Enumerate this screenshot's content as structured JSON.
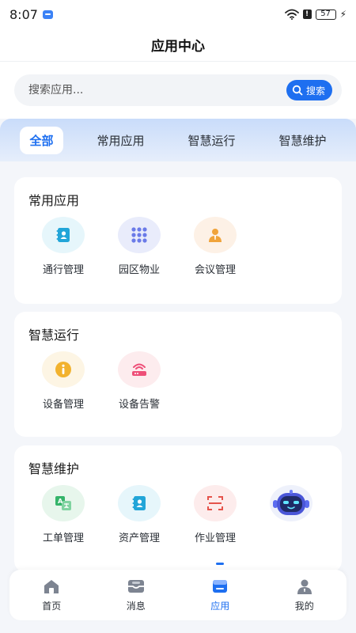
{
  "status": {
    "time": "8:07",
    "battery": "57"
  },
  "header": {
    "title": "应用中心"
  },
  "search": {
    "placeholder": "搜索应用...",
    "button_label": "搜索"
  },
  "tabs": [
    {
      "label": "全部",
      "active": true
    },
    {
      "label": "常用应用",
      "active": false
    },
    {
      "label": "智慧运行",
      "active": false
    },
    {
      "label": "智慧维护",
      "active": false
    }
  ],
  "sections": [
    {
      "title": "常用应用",
      "apps": [
        {
          "label": "通行管理",
          "icon": "contact-book-icon",
          "bg": "#e6f6fb",
          "color": "#22a5d8"
        },
        {
          "label": "园区物业",
          "icon": "grid-dots-icon",
          "bg": "#e9ecfb",
          "color": "#6b7be8"
        },
        {
          "label": "会议管理",
          "icon": "meeting-person-icon",
          "bg": "#fdf1e6",
          "color": "#f0a33a"
        }
      ]
    },
    {
      "title": "智慧运行",
      "apps": [
        {
          "label": "设备管理",
          "icon": "info-circle-icon",
          "bg": "#fdf5e4",
          "color": "#f2b22e"
        },
        {
          "label": "设备告警",
          "icon": "router-alarm-icon",
          "bg": "#fdecee",
          "color": "#ee4f78"
        }
      ]
    },
    {
      "title": "智慧维护",
      "apps": [
        {
          "label": "工单管理",
          "icon": "translate-card-icon",
          "bg": "#e7f6ec",
          "color": "#35b46a"
        },
        {
          "label": "资产管理",
          "icon": "contact-book-icon",
          "bg": "#e6f6fb",
          "color": "#22a5d8"
        },
        {
          "label": "作业管理",
          "icon": "scan-frame-icon",
          "bg": "#fdecec",
          "color": "#e5534b"
        },
        {
          "label": "",
          "icon": "robot-assistant-icon",
          "bg": "#eef1fb",
          "color": "#5a5fe0"
        }
      ]
    }
  ],
  "nav": [
    {
      "label": "首页",
      "icon": "home-icon",
      "active": false
    },
    {
      "label": "消息",
      "icon": "inbox-icon",
      "active": false
    },
    {
      "label": "应用",
      "icon": "apps-icon",
      "active": true
    },
    {
      "label": "我的",
      "icon": "user-icon",
      "active": false
    }
  ]
}
